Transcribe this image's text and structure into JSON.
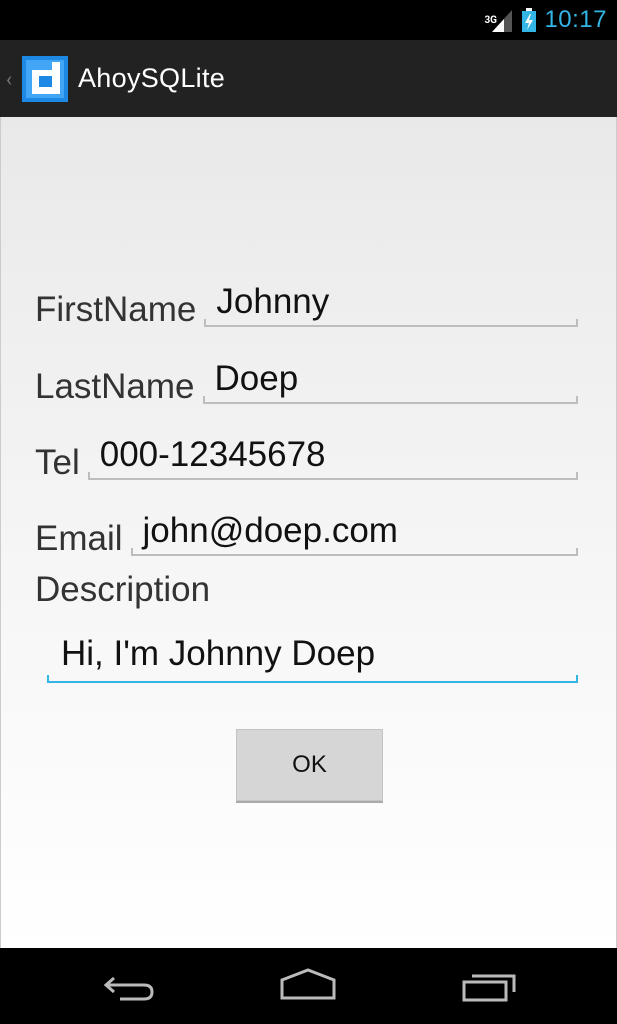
{
  "status_bar": {
    "network": "3G",
    "time": "10:17"
  },
  "action_bar": {
    "title": "AhoySQLite"
  },
  "form": {
    "first_name": {
      "label": "FirstName",
      "value": "Johnny"
    },
    "last_name": {
      "label": "LastName",
      "value": "Doep"
    },
    "tel": {
      "label": "Tel",
      "value": "000-12345678"
    },
    "email": {
      "label": "Email",
      "value": "john@doep.com"
    },
    "description": {
      "label": "Description",
      "value": "Hi, I'm Johnny Doep"
    }
  },
  "ok_button": {
    "label": "OK"
  },
  "colors": {
    "accent": "#33b5e5",
    "action_bar": "#222222",
    "status_bar": "#000000"
  }
}
